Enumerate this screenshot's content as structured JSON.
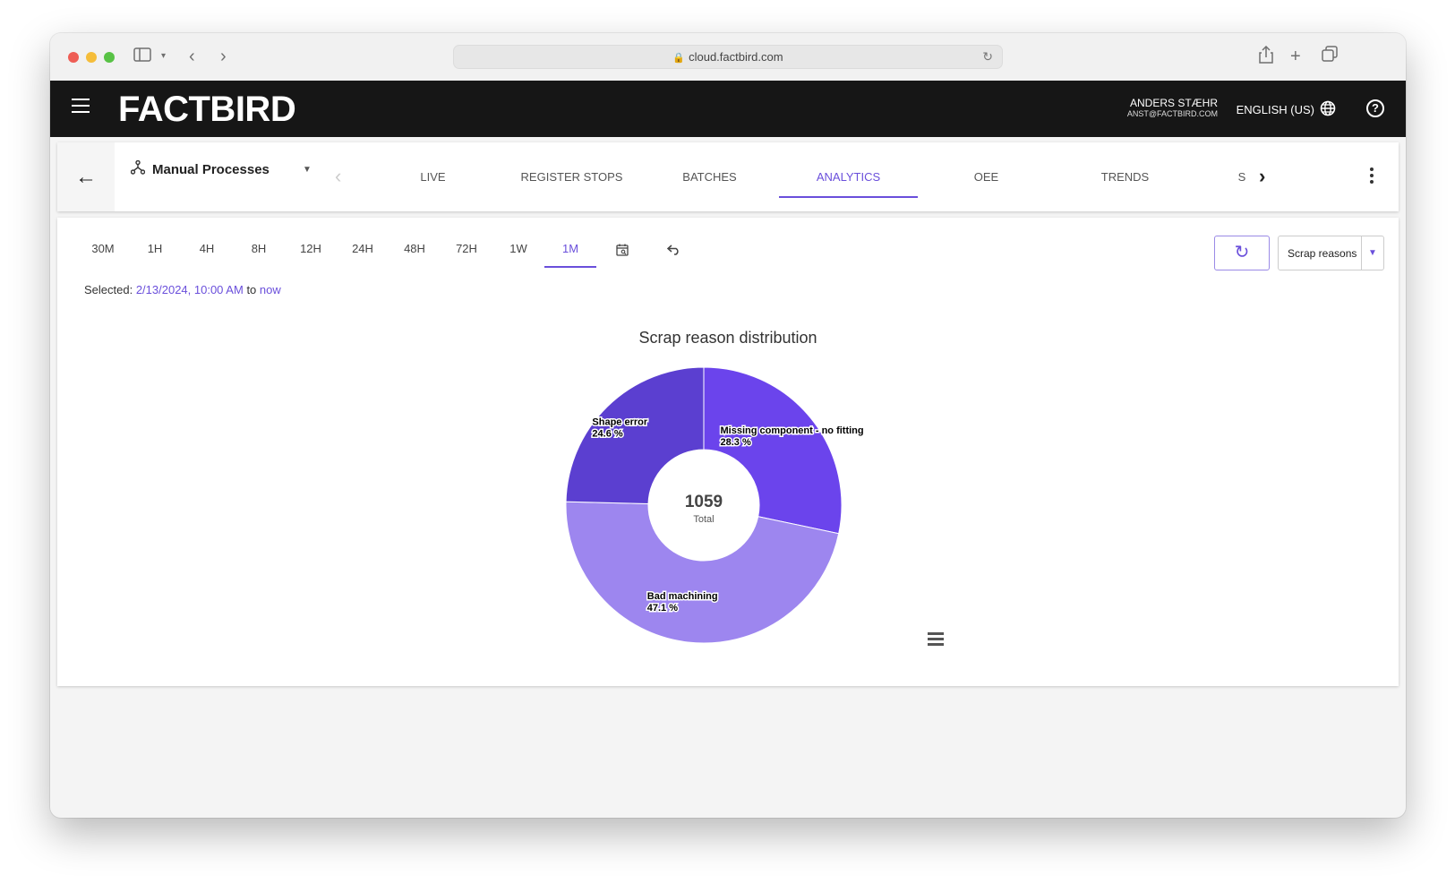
{
  "browser": {
    "url": "cloud.factbird.com"
  },
  "header": {
    "logo": "FACTBIRD",
    "user_name": "ANDERS STÆHR",
    "user_email": "ANST@FACTBIRD.COM",
    "language": "ENGLISH (US)"
  },
  "nav": {
    "process_name": "Manual Processes",
    "tabs": [
      {
        "label": "LIVE"
      },
      {
        "label": "REGISTER STOPS"
      },
      {
        "label": "BATCHES"
      },
      {
        "label": "ANALYTICS"
      },
      {
        "label": "OEE"
      },
      {
        "label": "TRENDS"
      }
    ],
    "truncated_tab": "S",
    "active_tab": "ANALYTICS"
  },
  "range": {
    "options": [
      "30M",
      "1H",
      "4H",
      "8H",
      "12H",
      "24H",
      "48H",
      "72H",
      "1W",
      "1M"
    ],
    "active": "1M",
    "selected_prefix": "Selected:",
    "selected_from": "2/13/2024, 10:00 AM",
    "selected_to_word": "to",
    "selected_to": "now"
  },
  "controls": {
    "dropdown_label": "Scrap reasons"
  },
  "colors": {
    "accent": "#6a4fdb",
    "slice_shape_error": "#5b3fd0",
    "slice_missing_component": "#6b44ec",
    "slice_bad_machining": "#9d86ef"
  },
  "chart_data": {
    "type": "pie",
    "title": "Scrap reason distribution",
    "center_value": "1059",
    "center_label": "Total",
    "slices": [
      {
        "name": "Missing component - no fitting",
        "percent_label": "28.3 %",
        "value": 28.3
      },
      {
        "name": "Bad machining",
        "percent_label": "47.1 %",
        "value": 47.1
      },
      {
        "name": "Shape error",
        "percent_label": "24.6 %",
        "value": 24.6
      }
    ]
  }
}
